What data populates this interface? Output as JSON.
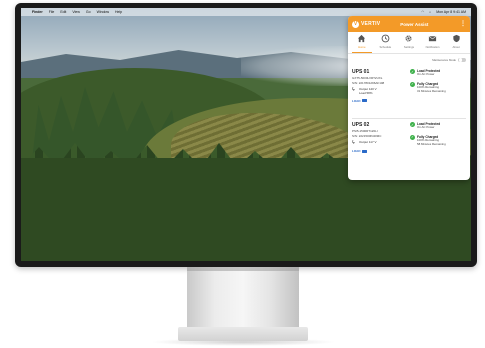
{
  "menubar": {
    "app": "Finder",
    "items": [
      "File",
      "Edit",
      "View",
      "Go",
      "Window",
      "Help"
    ],
    "clock": "Mon Apr 8  9:41 AM"
  },
  "app": {
    "brand": "VERTIV",
    "title": "Power Assist",
    "accent_color": "#f39a28",
    "tabs": [
      {
        "label": "Home",
        "icon": "home-icon"
      },
      {
        "label": "Schedule",
        "icon": "clock-icon"
      },
      {
        "label": "Settings",
        "icon": "gear-icon"
      },
      {
        "label": "Notification",
        "icon": "mail-icon"
      },
      {
        "label": "About",
        "icon": "shield-icon"
      }
    ],
    "maintenance_label": "Maintenance Mode",
    "ups": [
      {
        "name": "UPS 01",
        "model": "GXT5-5000LVRT2UXL",
        "sn_label": "S/N:",
        "sn": "2217801296AF108",
        "output": "Output 120 V",
        "load": "Load 58%",
        "load_link": "LOAD",
        "status1_title": "Load Protected",
        "status1_sub": "On AC Power",
        "status2_title": "Fully Charged",
        "status2_sub1": "100% Remaining",
        "status2_sub2": "31 Minutes Remaining"
      },
      {
        "name": "UPS 02",
        "model": "PSI5-1500RT120LI",
        "sn_label": "S/N:",
        "sn": "2221500IN409IC",
        "output": "Output 117 V",
        "load": "",
        "load_link": "LOAD",
        "status1_title": "Load Protected",
        "status1_sub": "On AC Power",
        "status2_title": "Fully Charged",
        "status2_sub1": "100% Remaining",
        "status2_sub2": "58 Minutes Remaining"
      }
    ]
  }
}
